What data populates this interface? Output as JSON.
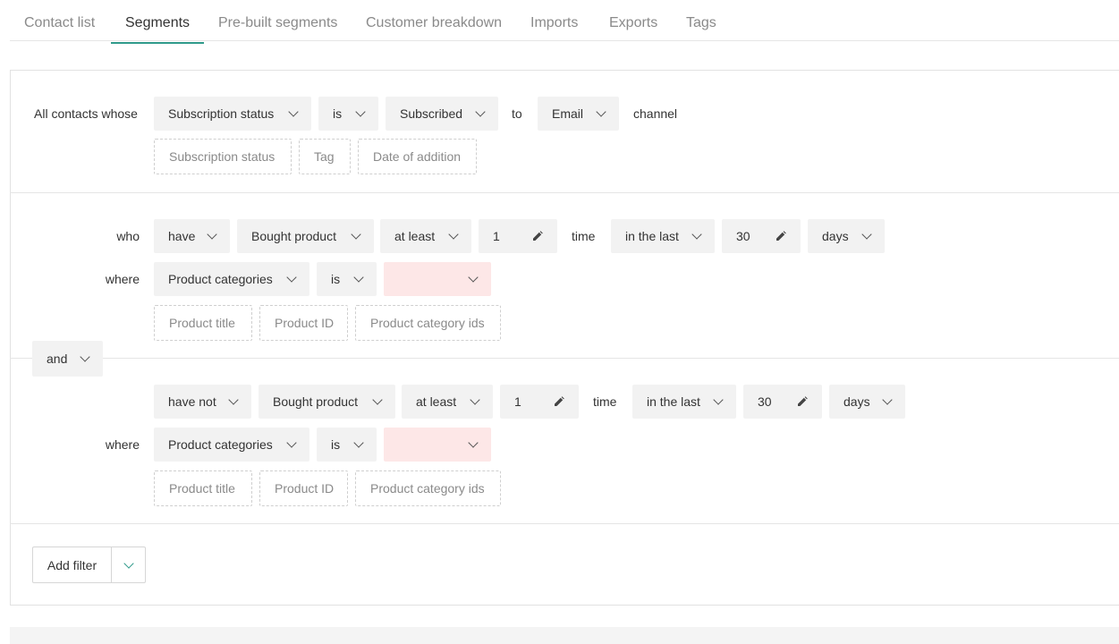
{
  "tabs": [
    {
      "label": "Contact list",
      "active": false
    },
    {
      "label": "Segments",
      "active": true
    },
    {
      "label": "Pre-built segments",
      "active": false
    },
    {
      "label": "Customer breakdown",
      "active": false
    },
    {
      "label": "Imports",
      "active": false
    },
    {
      "label": "Exports",
      "active": false
    },
    {
      "label": "Tags",
      "active": false
    }
  ],
  "colors": {
    "accent": "#2f9a8a",
    "empty_select": "#fde7e7"
  },
  "audience": {
    "prefix": "All contacts whose",
    "field": "Subscription status",
    "operator": "is",
    "value": "Subscribed",
    "to": "to",
    "channel": "Email",
    "suffix": "channel",
    "suggestions": [
      "Subscription status",
      "Tag",
      "Date of addition"
    ]
  },
  "combinator": "and",
  "conditions": [
    {
      "lead": "who",
      "verb": "have",
      "event": "Bought product",
      "quantifier": "at least",
      "count": "1",
      "time_word": "time",
      "period_op": "in the last",
      "period_value": "30",
      "period_unit": "days",
      "where": "where",
      "where_field": "Product categories",
      "where_op": "is",
      "where_value": "",
      "suggestions": [
        "Product title",
        "Product ID",
        "Product category ids"
      ]
    },
    {
      "lead": "",
      "verb": "have not",
      "event": "Bought product",
      "quantifier": "at least",
      "count": "1",
      "time_word": "time",
      "period_op": "in the last",
      "period_value": "30",
      "period_unit": "days",
      "where": "where",
      "where_field": "Product categories",
      "where_op": "is",
      "where_value": "",
      "suggestions": [
        "Product title",
        "Product ID",
        "Product category ids"
      ]
    }
  ],
  "add_filter": {
    "label": "Add filter"
  }
}
